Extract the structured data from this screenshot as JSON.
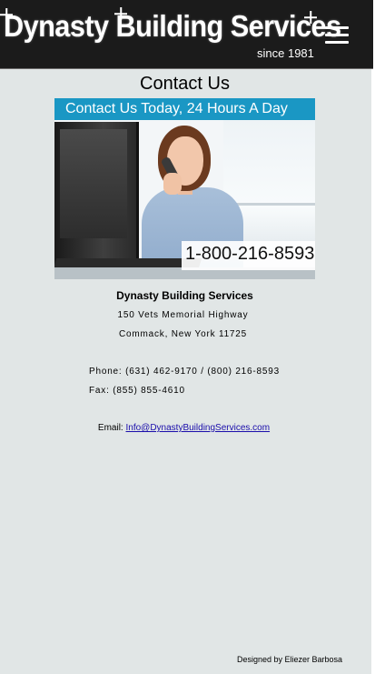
{
  "header": {
    "logo_title": "Dynasty Building Services",
    "logo_tagline": "since 1981",
    "menu_icon": "hamburger-menu-icon"
  },
  "main": {
    "title": "Contact Us",
    "banner": {
      "headline": "Contact Us Today, 24 Hours A Day",
      "phone": "1-800-216-8593",
      "accent_color": "#1a97c4"
    },
    "company_name": "Dynasty Building Services",
    "address_line1": "150 Vets Memorial Highway",
    "address_line2": "Commack, New York 11725",
    "phone_line": "Phone: (631) 462-9170 / (800) 216-8593",
    "fax_line": "Fax: (855) 855-4610",
    "email_label": "Email:",
    "email": "Info@DynastyBuildingServices.com"
  },
  "footer": {
    "credit": "Designed by Eliezer Barbosa"
  },
  "colors": {
    "header_bg": "#1b1b1b",
    "page_bg": "#e1e6e6",
    "link": "#1a0dab"
  }
}
